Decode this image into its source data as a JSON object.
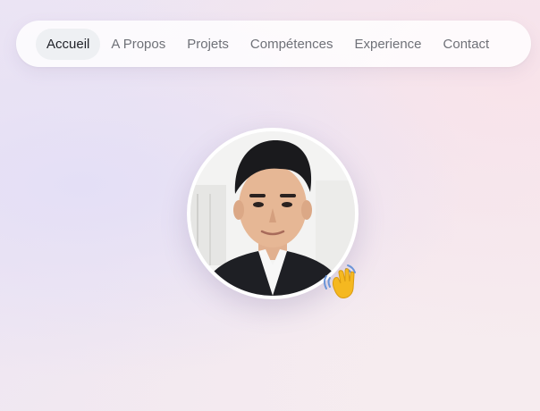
{
  "nav": {
    "items": [
      {
        "label": "Accueil",
        "active": true
      },
      {
        "label": "A Propos"
      },
      {
        "label": "Projets"
      },
      {
        "label": "Compétences"
      },
      {
        "label": "Experience"
      },
      {
        "label": "Contact"
      }
    ]
  },
  "hero": {
    "avatar_icon": "profile-photo",
    "wave_icon": "waving-hand-emoji"
  },
  "colors": {
    "nav_active_bg": "#eef0f3",
    "nav_text": "#6f7178",
    "nav_active_text": "#1f2128",
    "wave": "#f5b820"
  }
}
